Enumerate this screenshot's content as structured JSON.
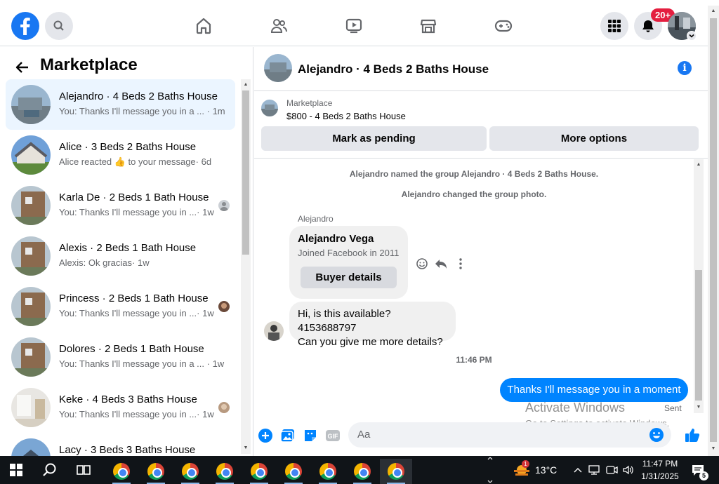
{
  "colors": {
    "brand": "#1877f2",
    "outgoing_bubble": "#0084ff",
    "badge": "#e41e3f",
    "active_conv": "#ebf5ff"
  },
  "topbar": {
    "logo": "facebook-logo",
    "search_icon": "search-icon",
    "nav": [
      "home-icon",
      "friends-icon",
      "video-icon",
      "marketplace-icon",
      "gaming-icon"
    ],
    "notification_badge": "20+"
  },
  "sidebar": {
    "title": "Marketplace",
    "conversations": [
      {
        "name": "Alejandro · 4 Beds 2 Baths House",
        "preview": "You: Thanks I'll message you in a ...",
        "time": "· 1m",
        "active": true
      },
      {
        "name": "Alice · 3 Beds 2 Baths House",
        "preview": "Alice reacted 👍 to your message",
        "time": "· 6d"
      },
      {
        "name": "Karla De · 2 Beds 1 Bath House",
        "preview": "You: Thanks I'll message you in ...",
        "time": "· 1w"
      },
      {
        "name": "Alexis · 2 Beds 1 Bath House",
        "preview": "Alexis: Ok gracias",
        "time": "· 1w"
      },
      {
        "name": "Princess · 2 Beds 1 Bath House",
        "preview": "You: Thanks I'll message you in ...",
        "time": "· 1w"
      },
      {
        "name": "Dolores · 2 Beds 1 Bath House",
        "preview": "You: Thanks I'll message you in a ...",
        "time": "· 1w"
      },
      {
        "name": "Keke · 4 Beds 3 Baths House",
        "preview": "You: Thanks I'll message you in ...",
        "time": "· 1w"
      },
      {
        "name": "Lacy · 3 Beds 3 Baths House",
        "preview": "",
        "time": ""
      }
    ]
  },
  "chat": {
    "title": "Alejandro · 4 Beds 2 Baths House",
    "listing": {
      "source": "Marketplace",
      "summary": "$800 - 4 Beds 2 Baths House"
    },
    "buttons": {
      "pending": "Mark as pending",
      "more": "More options"
    },
    "system_messages": [
      "Alejandro named the group Alejandro · 4 Beds 2 Baths House.",
      "Alejandro changed the group photo."
    ],
    "sender_label": "Alejandro",
    "profile_card": {
      "name": "Alejandro Vega",
      "joined": "Joined Facebook in 2011",
      "button": "Buyer details"
    },
    "incoming": [
      "Hi, is this available? 4153688797",
      "Can you give me more details?"
    ],
    "timestamp": "11:46 PM",
    "outgoing": "Thanks I'll message you in a moment",
    "status": "Sent",
    "composer_placeholder": "Aa"
  },
  "watermark": {
    "line1": "Activate Windows",
    "line2": "Go to Settings to activate Windows."
  },
  "taskbar": {
    "weather": "13°C",
    "weather_badge": "1",
    "time": "11:47 PM",
    "date": "1/31/2025",
    "notifications": "5",
    "apps_count": 9
  }
}
